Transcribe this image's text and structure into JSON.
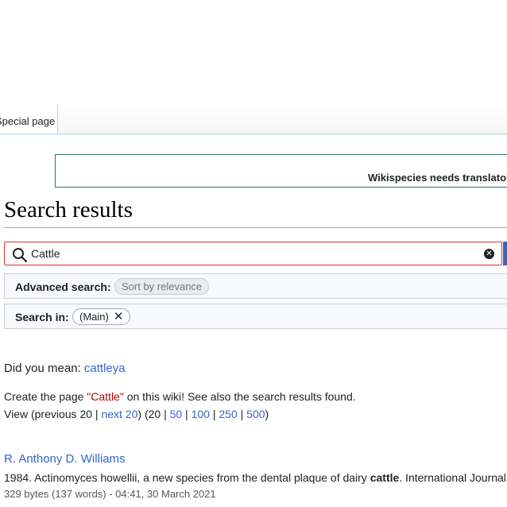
{
  "tabs": {
    "special_page": "Special page"
  },
  "notice": {
    "text": "Wikispecies needs translators"
  },
  "page": {
    "title": "Search results"
  },
  "search": {
    "value": "Cattle",
    "clear_symbol": "✕"
  },
  "advanced": {
    "label": "Advanced search:",
    "sort_chip": "Sort by relevance",
    "search_in_label": "Search in:",
    "namespace_chip": "(Main)",
    "remove_symbol": "✕"
  },
  "suggestion": {
    "prefix": "Did you mean: ",
    "term": "cattleya"
  },
  "create": {
    "before": "Create the page ",
    "page_link": "\"Cattle\"",
    "after": " on this wiki! See also the search results found."
  },
  "paging": {
    "view_text": "View (previous 20 | ",
    "next_label": "next 20",
    "mid_text": ") (20 | ",
    "limits": [
      "50",
      "100",
      "250",
      "500"
    ],
    "sep": " | ",
    "close": ")"
  },
  "results": [
    {
      "title": "R. Anthony D. Williams",
      "snippet_before": "1984. Actinomyces howellii, a new species from the dental plaque of dairy ",
      "snippet_match": "cattle",
      "snippet_after": ". International Journal",
      "meta": "329 bytes (137 words) - 04:41, 30 March 2021"
    }
  ],
  "colors": {
    "link": "#3366cc",
    "redlink": "#ba0000",
    "search_border": "#dd3333",
    "notice_border": "#2a7a5c"
  }
}
